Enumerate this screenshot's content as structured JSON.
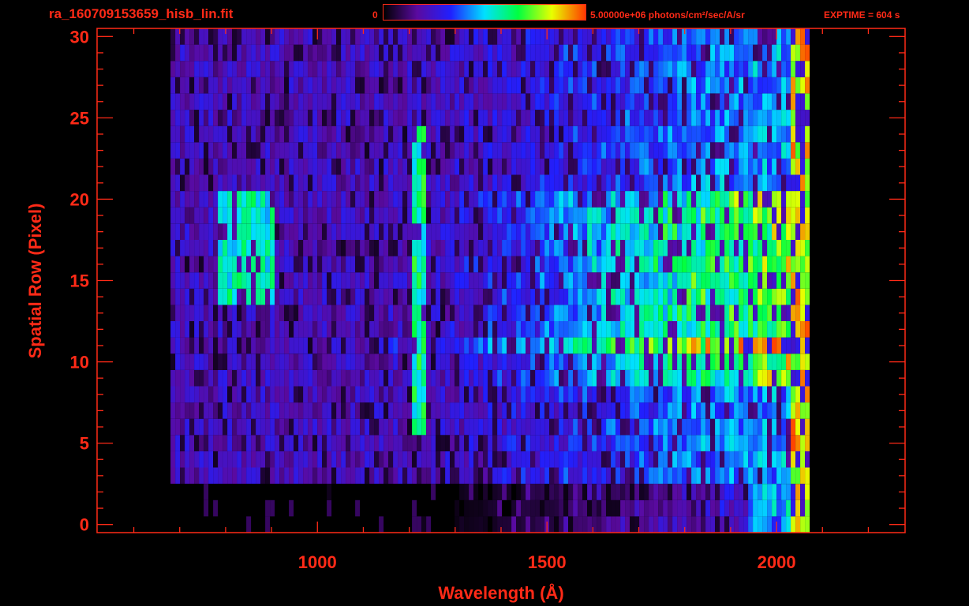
{
  "header": {
    "file_name": "ra_160709153659_hisb_lin.fit",
    "colorbar_min": "0",
    "colorbar_max": "5.00000e+06 photons/cm²/sec/A/sr",
    "exptime": "EXPTIME = 604 s"
  },
  "colors": {
    "axis": "#ff2a17",
    "background": "#000000",
    "colormap": [
      "#000000",
      "#5a0aa0",
      "#2020ff",
      "#00e0ff",
      "#00ff40",
      "#e8ff00",
      "#ff3a00"
    ]
  },
  "chart_data": {
    "type": "heatmap",
    "title": "",
    "xlabel": "Wavelength (Å)",
    "ylabel": "Spatial Row (Pixel)",
    "xlim": [
      520,
      2280
    ],
    "ylim": [
      -0.5,
      30.5
    ],
    "x_ticks": [
      1000,
      1500,
      2000
    ],
    "y_ticks": [
      0,
      5,
      10,
      15,
      20,
      25,
      30
    ],
    "colorbar": {
      "min": 0,
      "max": 5000000,
      "units": "photons/cm²/sec/A/sr"
    },
    "rows": [
      0,
      30
    ],
    "emission_features": [
      {
        "wavelength": 840,
        "rows": [
          14,
          20
        ],
        "level": 0.55
      },
      {
        "wavelength": 1216,
        "rows": [
          6,
          24
        ],
        "level": 0.6
      }
    ],
    "continuum": {
      "start_wavelength": 680,
      "end_wavelength": 2070,
      "bright_rows": [
        9,
        20
      ],
      "peak_level": 0.75
    }
  }
}
